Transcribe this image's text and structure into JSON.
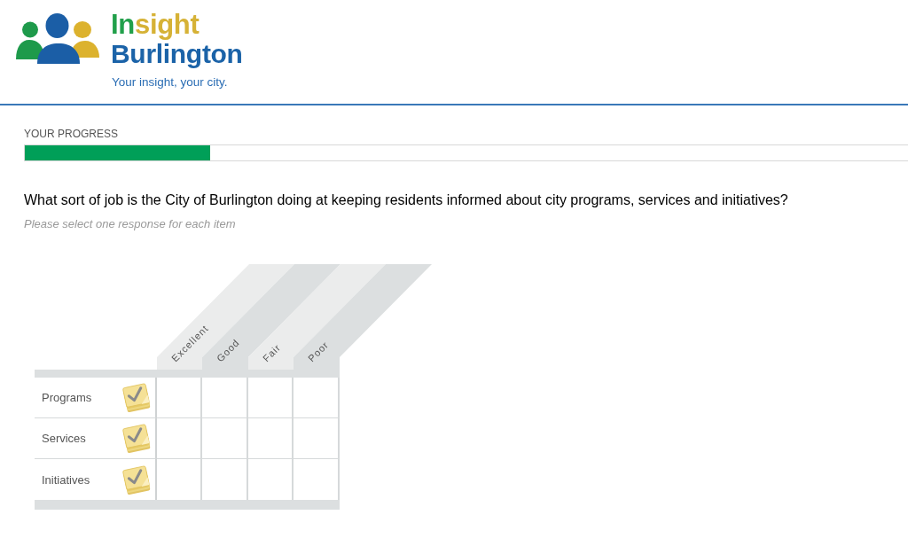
{
  "header": {
    "logo": {
      "title_parts": [
        {
          "text": "In",
          "color": "#22a04b"
        },
        {
          "text": "sight",
          "color": "#d6b236"
        }
      ],
      "subtitle": "Burlington",
      "tagline": "Your insight, your city."
    }
  },
  "progress": {
    "label": "YOUR PROGRESS",
    "level": 0.21
  },
  "question": {
    "text": "What sort of job is the City of Burlington doing at keeping residents informed about city programs, services and initiatives?",
    "instruction": "Please select one response for each item",
    "grid": {
      "columns": [
        "Excellent",
        "Good",
        "Fair",
        "Poor"
      ],
      "rows": [
        {
          "label": "Programs",
          "responses": [
            {
              "selected": false
            },
            {
              "selected": false
            },
            {
              "selected": false
            },
            {
              "selected": false
            }
          ]
        },
        {
          "label": "Services",
          "responses": [
            {
              "selected": false
            },
            {
              "selected": false
            },
            {
              "selected": false
            },
            {
              "selected": false
            }
          ]
        },
        {
          "label": "Initiatives",
          "responses": [
            {
              "selected": false
            },
            {
              "selected": false
            },
            {
              "selected": false
            },
            {
              "selected": false
            }
          ]
        }
      ]
    }
  }
}
